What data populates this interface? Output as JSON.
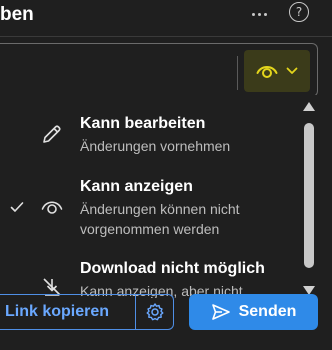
{
  "header": {
    "title": "ben",
    "more_icon": "more-horizontal-icon",
    "help_icon": "help-icon",
    "help_glyph": "?"
  },
  "permission_button": {
    "icon": "eye-icon",
    "dropdown_icon": "chevron-down-icon",
    "accent_color": "#e3d51c"
  },
  "menu": {
    "items": [
      {
        "icon": "pencil-icon",
        "title": "Kann bearbeiten",
        "description": "Änderungen vornehmen",
        "selected": false
      },
      {
        "icon": "eye-icon",
        "title": "Kann anzeigen",
        "description": "Änderungen können nicht vorgenommen werden",
        "selected": true
      },
      {
        "icon": "no-download-icon",
        "title": "Download nicht möglich",
        "description": "Kann anzeigen, aber nicht",
        "selected": false
      }
    ]
  },
  "footer": {
    "link_label": "Link kopieren",
    "settings_icon": "gear-icon",
    "send_label": "Senden",
    "send_icon": "send-icon",
    "link_color": "#6aa8ff",
    "send_color": "#2f8ae8"
  }
}
